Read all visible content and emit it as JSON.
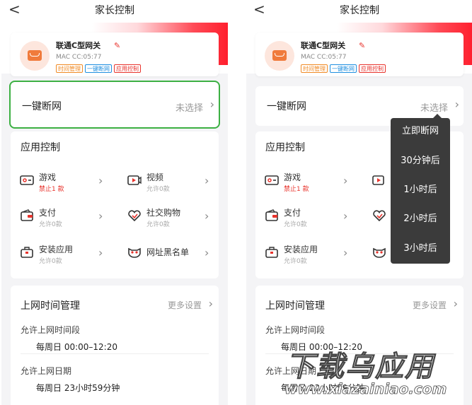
{
  "header": {
    "back": "<",
    "title": "家长控制"
  },
  "device": {
    "name": "联通C型网关",
    "mac": "MAC CC:05:77",
    "tags": [
      {
        "label": "时间管理",
        "color": "#f08a24"
      },
      {
        "label": "一键断网",
        "color": "#1f8fe0"
      },
      {
        "label": "应用控制",
        "color": "#e8332c"
      }
    ]
  },
  "one_key": {
    "label": "一键断网",
    "value": "未选择"
  },
  "app_control": {
    "title": "应用控制",
    "apps": [
      {
        "name": "游戏",
        "sub": "禁止1 款",
        "icon": "game-icon"
      },
      {
        "name": "视频",
        "sub": "允许0款",
        "icon": "video-icon"
      },
      {
        "name": "支付",
        "sub": "允许0款",
        "icon": "wallet-icon"
      },
      {
        "name": "社交购物",
        "sub": "允许0款",
        "icon": "heart-icon"
      },
      {
        "name": "安装应用",
        "sub": "允许0款",
        "icon": "toolbox-icon"
      },
      {
        "name": "网址黑名单",
        "sub": "",
        "icon": "mask-icon"
      }
    ]
  },
  "time_mgmt": {
    "title": "上网时间管理",
    "more": "更多设置",
    "period_label": "允许上网时间段",
    "period_value": "每周日  00:00–12:20",
    "date_label": "允许上网日期",
    "date_value": "每周日 23小时59分钟"
  },
  "dropdown": {
    "items": [
      "立即断网",
      "30分钟后",
      "1小时后",
      "2小时后",
      "3小时后"
    ]
  },
  "watermark": {
    "title": "下载乌应用",
    "url": "www.xiazainiao.com"
  },
  "colors": {
    "accent_red": "#e8332c",
    "highlight_green": "#3cb043",
    "dropdown_bg": "#3b3b3b"
  }
}
